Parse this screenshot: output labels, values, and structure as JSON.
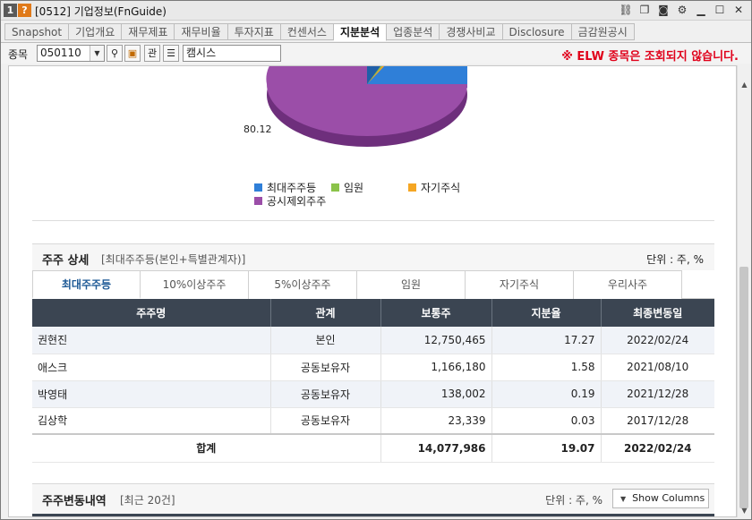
{
  "window": {
    "badge1": "1",
    "badge2": "?",
    "title": "[0512] 기업정보(FnGuide)",
    "icons": [
      "link-icon",
      "copy-icon",
      "camera-icon",
      "gear-icon",
      "minimize-icon",
      "maximize-icon",
      "close-icon"
    ]
  },
  "tabs": [
    {
      "label": "Snapshot"
    },
    {
      "label": "기업개요"
    },
    {
      "label": "재무제표"
    },
    {
      "label": "재무비율"
    },
    {
      "label": "투자지표"
    },
    {
      "label": "컨센서스"
    },
    {
      "label": "지분분석"
    },
    {
      "label": "업종분석"
    },
    {
      "label": "경쟁사비교"
    },
    {
      "label": "Disclosure"
    },
    {
      "label": "금감원공시"
    }
  ],
  "active_tab": "지분분석",
  "toolbar": {
    "code_label": "종목",
    "code_value": "050110",
    "btn_relation": "관",
    "company_name": "캠시스",
    "warning": "※ ELW 종목은 조회되지 않습니다."
  },
  "pie": {
    "value_label": "80.12",
    "colors": {
      "major": "#2f7fd8",
      "officers": "#8bc34a",
      "treasury": "#f5a623",
      "others": "#9b4ea8"
    },
    "legend": [
      {
        "label": "최대주주등",
        "color": "#2f7fd8"
      },
      {
        "label": "임원",
        "color": "#8bc34a"
      },
      {
        "label": "자기주식",
        "color": "#f5a623"
      },
      {
        "label": "공시제외주주",
        "color": "#9b4ea8"
      }
    ]
  },
  "holders": {
    "title": "주주 상세",
    "subtitle": "[최대주주등(본인+특별관계자)]",
    "unit": "단위 : 주, %",
    "subtabs": [
      "최대주주등",
      "10%이상주주",
      "5%이상주주",
      "임원",
      "자기주식",
      "우리사주"
    ],
    "columns": [
      "주주명",
      "관계",
      "보통주",
      "지분율",
      "최종변동일"
    ],
    "rows": [
      [
        "권현진",
        "본인",
        "12,750,465",
        "17.27",
        "2022/02/24"
      ],
      [
        "애스크",
        "공동보유자",
        "1,166,180",
        "1.58",
        "2021/08/10"
      ],
      [
        "박영태",
        "공동보유자",
        "138,002",
        "0.19",
        "2021/12/28"
      ],
      [
        "김상학",
        "공동보유자",
        "23,339",
        "0.03",
        "2017/12/28"
      ]
    ],
    "total": [
      "합계",
      "14,077,986",
      "19.07",
      "2022/02/24"
    ]
  },
  "changes": {
    "title": "주주변동내역",
    "subtitle": "[최근 20건]",
    "unit": "단위 : 주, %",
    "show_columns": "Show Columns"
  }
}
